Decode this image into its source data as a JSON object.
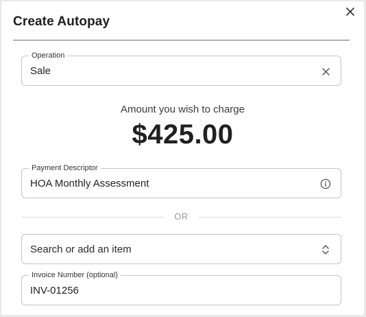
{
  "dialog": {
    "title": "Create Autopay",
    "close_icon": "close-icon"
  },
  "operation": {
    "label": "Operation",
    "value": "Sale",
    "clear_icon": "clear-icon"
  },
  "amount": {
    "caption": "Amount you wish to charge",
    "value": "$425.00"
  },
  "payment_descriptor": {
    "label": "Payment Descriptor",
    "value": "HOA Monthly Assessment",
    "info_icon": "info-icon"
  },
  "separator": {
    "text": "OR"
  },
  "item_search": {
    "placeholder": "Search or add an item",
    "icon": "chevron-up-down-icon"
  },
  "invoice_number": {
    "label": "Invoice Number (optional)",
    "value": "INV-01256"
  }
}
